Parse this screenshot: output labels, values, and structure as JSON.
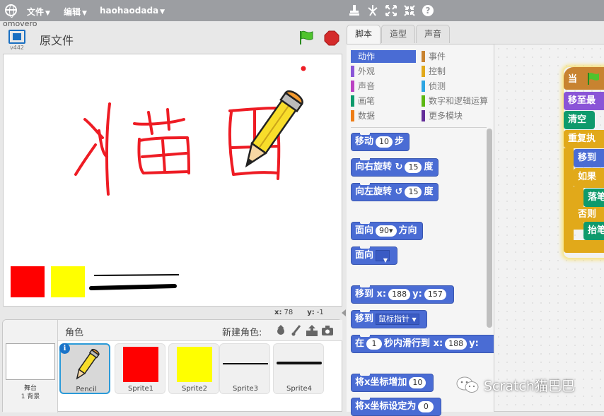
{
  "menubar": {
    "file_label": "文件",
    "edit_label": "编辑",
    "username": "haohaodada",
    "overflow_text": "omovero"
  },
  "stage_header": {
    "version": "v442",
    "project_title": "原文件"
  },
  "stage": {
    "drawing_text": "猫巴",
    "coords": {
      "x_label": "x:",
      "x_value": "78",
      "y_label": "y:",
      "y_value": "-1"
    }
  },
  "sprite_panel": {
    "stage_label": "舞台",
    "stage_backdrops": "1 背景",
    "sprites_title": "角色",
    "new_sprite_label": "新建角色:",
    "sprites": [
      {
        "name": "Pencil",
        "selected": true
      },
      {
        "name": "Sprite1",
        "color": "#ff0000"
      },
      {
        "name": "Sprite2",
        "color": "#ffff00"
      },
      {
        "name": "Sprite3"
      },
      {
        "name": "Sprite4"
      }
    ]
  },
  "tabs": [
    {
      "label": "脚本",
      "active": true
    },
    {
      "label": "造型"
    },
    {
      "label": "声音"
    }
  ],
  "categories": [
    {
      "label": "动作",
      "color": "#4a6cd4",
      "active": true
    },
    {
      "label": "事件",
      "color": "#c88330"
    },
    {
      "label": "外观",
      "color": "#8a55d7"
    },
    {
      "label": "控制",
      "color": "#e1a91a"
    },
    {
      "label": "声音",
      "color": "#bb42c3"
    },
    {
      "label": "侦测",
      "color": "#2ca5e2"
    },
    {
      "label": "画笔",
      "color": "#0e9a6c"
    },
    {
      "label": "数字和逻辑运算",
      "color": "#5cb712"
    },
    {
      "label": "数据",
      "color": "#ee7d16"
    },
    {
      "label": "更多模块",
      "color": "#632d99"
    }
  ],
  "palette_blocks": {
    "move": {
      "pre": "移动",
      "value": "10",
      "post": "步"
    },
    "turn_right": {
      "pre": "向右旋转",
      "icon": "↻",
      "value": "15",
      "post": "度"
    },
    "turn_left": {
      "pre": "向左旋转",
      "icon": "↺",
      "value": "15",
      "post": "度"
    },
    "point_dir": {
      "pre": "面向",
      "value": "90▾",
      "post": "方向"
    },
    "point_towards": {
      "pre": "面向"
    },
    "goto_xy": {
      "pre": "移到",
      "x_label": "x:",
      "x_value": "188",
      "y_label": "y:",
      "y_value": "157"
    },
    "goto": {
      "pre": "移到",
      "value": "鼠标指针"
    },
    "glide": {
      "pre": "在",
      "value": "1",
      "mid": "秒内滑行到",
      "x_label": "x:",
      "x_value": "188",
      "y_label": "y:"
    },
    "change_x": {
      "pre": "将x坐标增加",
      "value": "10"
    },
    "set_x": {
      "pre": "将x坐标设定为",
      "value": "0"
    }
  },
  "script_blocks": {
    "when_flag": "当",
    "goto_front": "移至最",
    "clear": "清空",
    "forever": "重复执",
    "goto": "移到",
    "if": "如果",
    "pen_down": "落笔",
    "else": "否则",
    "pen_up": "抬笔"
  },
  "watermark": "Scratch猫巴巴",
  "colors": {
    "menubar": "#9c9ea2",
    "motion": "#4a6cd4",
    "pen": "#0e9a6c",
    "control": "#e1a91a",
    "looks": "#8a55d7",
    "events": "#c88330",
    "drawing_red": "#ff0000"
  }
}
